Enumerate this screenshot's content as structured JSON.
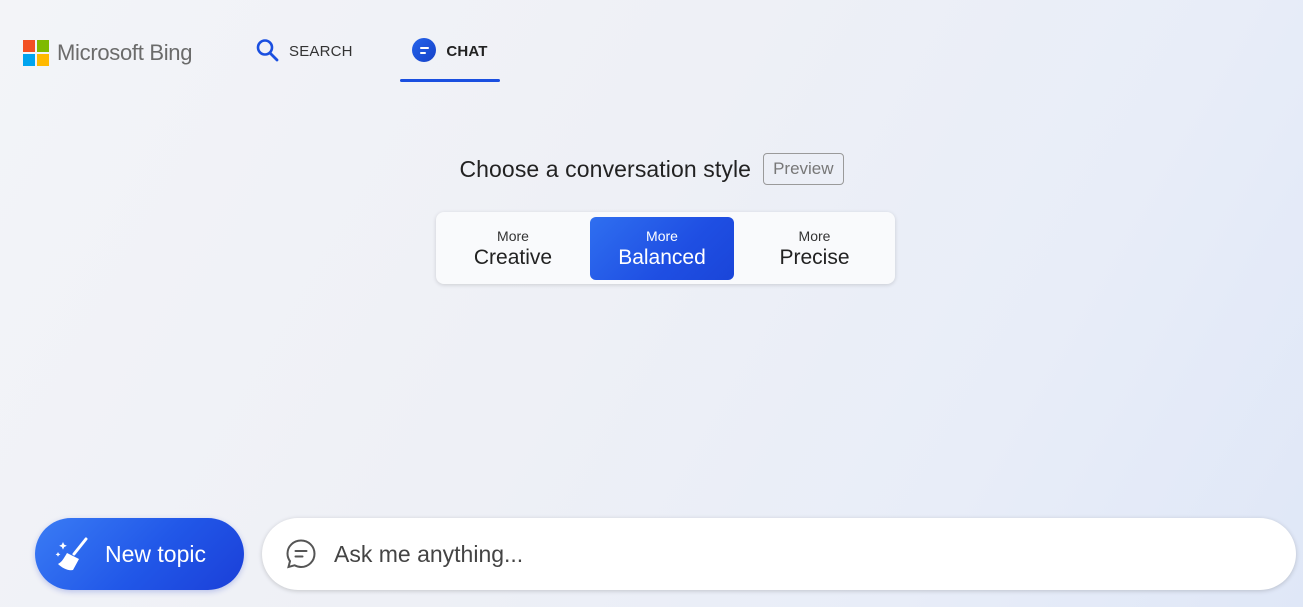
{
  "header": {
    "brand": "Microsoft Bing",
    "tabs": [
      {
        "label": "SEARCH",
        "icon": "search-icon"
      },
      {
        "label": "CHAT",
        "icon": "chat-bubble-icon",
        "selected": true
      }
    ]
  },
  "conversation_style": {
    "title": "Choose a conversation style",
    "badge": "Preview",
    "options": [
      {
        "prefix": "More",
        "label": "Creative",
        "selected": false
      },
      {
        "prefix": "More",
        "label": "Balanced",
        "selected": true
      },
      {
        "prefix": "More",
        "label": "Precise",
        "selected": false
      }
    ]
  },
  "footer": {
    "new_topic_label": "New topic",
    "input_placeholder": "Ask me anything...",
    "input_value": ""
  },
  "colors": {
    "accent": "#1a4fe0",
    "ms_red": "#f25022",
    "ms_green": "#7fba00",
    "ms_blue": "#00a4ef",
    "ms_yellow": "#ffb900"
  }
}
